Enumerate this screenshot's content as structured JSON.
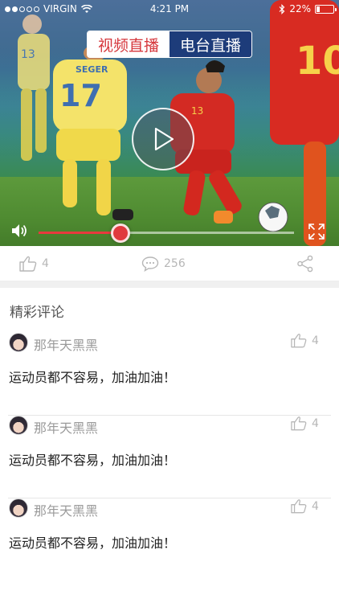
{
  "status_bar": {
    "carrier": "VIRGIN",
    "time": "4:21 PM",
    "battery": "22%",
    "battery_level": 0.22
  },
  "tabs": [
    {
      "label": "视频直播",
      "active": true
    },
    {
      "label": "电台直播",
      "active": false
    }
  ],
  "video": {
    "progress": 0.32,
    "jersey_numbers": [
      "13",
      "17",
      "13",
      "10"
    ],
    "jersey_name": "SEGER"
  },
  "actions": {
    "likes": "4",
    "comments": "256"
  },
  "comments_section": {
    "title": "精彩评论",
    "items": [
      {
        "user": "那年天黑黑",
        "likes": "4",
        "text": "运动员都不容易，加油加油！"
      },
      {
        "user": "那年天黑黑",
        "likes": "4",
        "text": "运动员都不容易，加油加油！"
      },
      {
        "user": "那年天黑黑",
        "likes": "4",
        "text": "运动员都不容易，加油加油！"
      }
    ]
  },
  "colors": {
    "accent_red": "#d6373c",
    "tab_blue": "#1d3c7a",
    "icon_gray": "#b7b7b7"
  },
  "icons": [
    "wifi-icon",
    "bluetooth-icon",
    "battery-icon",
    "play-icon",
    "volume-icon",
    "fullscreen-icon",
    "thumbs-up-icon",
    "comment-icon",
    "share-icon"
  ]
}
